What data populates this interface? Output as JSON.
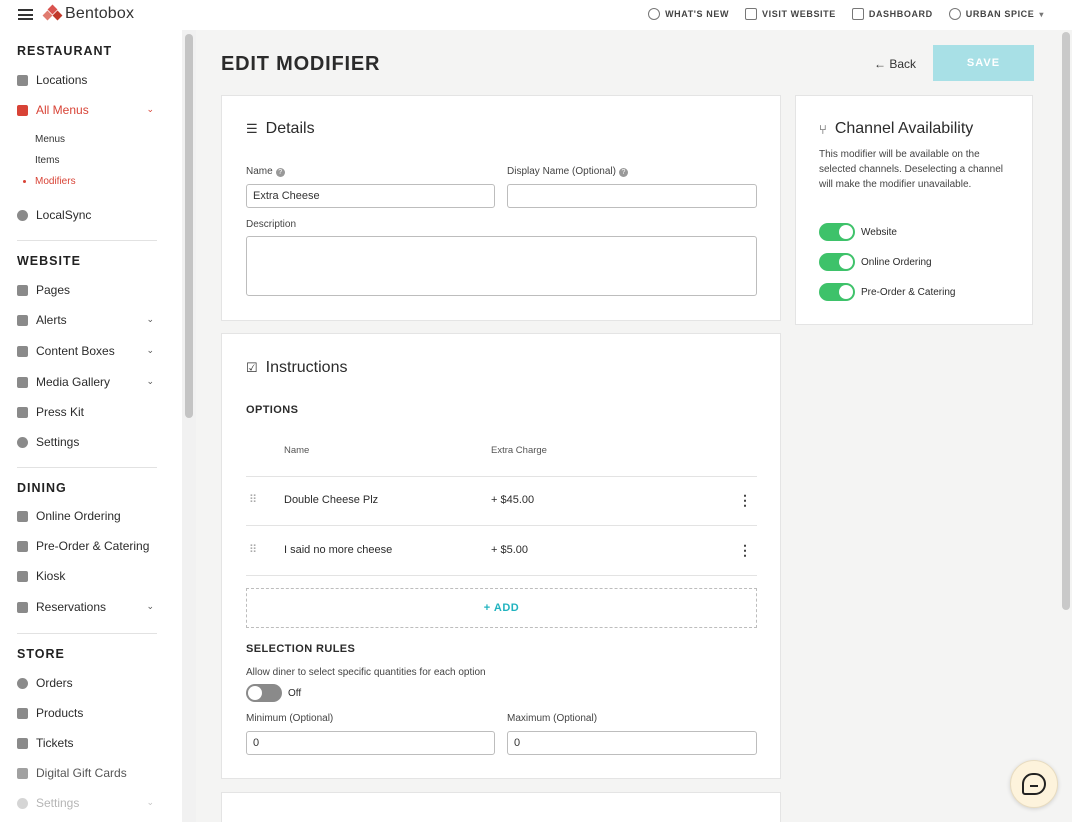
{
  "topbar": {
    "brand": "Bentobox",
    "nav": [
      "WHAT'S NEW",
      "VISIT WEBSITE",
      "DASHBOARD",
      "URBAN SPICE"
    ]
  },
  "sidebar": {
    "sections": {
      "restaurant": "RESTAURANT",
      "website": "WEBSITE",
      "dining": "DINING",
      "store": "STORE"
    },
    "restaurant_items": [
      "Locations",
      "All Menus",
      "LocalSync"
    ],
    "menu_subitems": [
      "Menus",
      "Items",
      "Modifiers"
    ],
    "website_items": [
      "Pages",
      "Alerts",
      "Content Boxes",
      "Media Gallery",
      "Press Kit",
      "Settings"
    ],
    "dining_items": [
      "Online Ordering",
      "Pre-Order & Catering",
      "Kiosk",
      "Reservations"
    ],
    "store_items": [
      "Orders",
      "Products",
      "Tickets",
      "Digital Gift Cards",
      "Settings"
    ]
  },
  "page": {
    "title": "EDIT MODIFIER",
    "back_label": "Back",
    "save_label": "SAVE"
  },
  "details": {
    "title": "Details",
    "name_label": "Name",
    "name_value": "Extra Cheese",
    "display_name_label": "Display Name (Optional)",
    "display_name_value": "",
    "description_label": "Description"
  },
  "instructions": {
    "title": "Instructions",
    "options_label": "OPTIONS",
    "col_name": "Name",
    "col_charge": "Extra Charge",
    "options": [
      {
        "name": "Double Cheese Plz",
        "charge": "+ $45.00"
      },
      {
        "name": "I said no more cheese",
        "charge": "+ $5.00"
      }
    ],
    "add_label": "+ ADD",
    "selection_rules_label": "SELECTION RULES",
    "quantity_label": "Allow diner to select specific quantities for each option",
    "quantity_state": "Off",
    "min_label": "Minimum (Optional)",
    "min_value": "0",
    "max_label": "Maximum (Optional)",
    "max_value": "0"
  },
  "channels": {
    "title": "Channel Availability",
    "description": "This modifier will be available on the selected channels. Deselecting a channel will make the modifier unavailable.",
    "items": [
      "Website",
      "Online Ordering",
      "Pre-Order & Catering"
    ]
  },
  "colors": {
    "accent": "#d84336",
    "teal": "#21b3bf",
    "save_disabled": "#a8e0e6",
    "toggle_on": "#3ec26a"
  }
}
